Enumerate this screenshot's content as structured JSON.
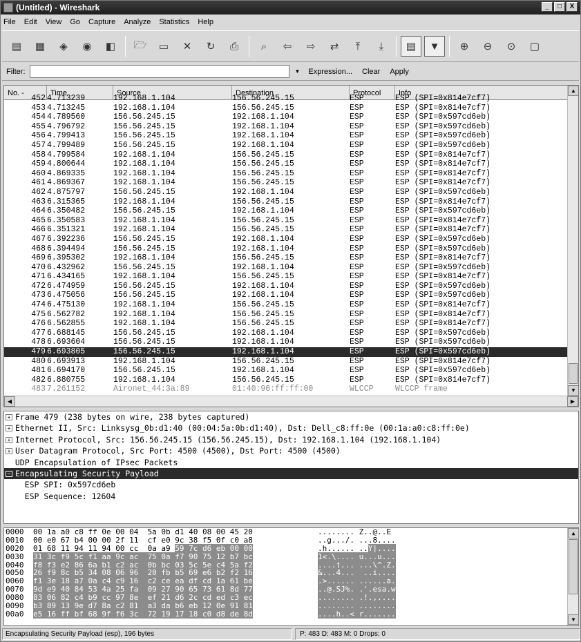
{
  "window": {
    "title": "(Untitled) - Wireshark",
    "minimize": "_",
    "maximize": "□",
    "close": "X"
  },
  "menu": [
    "File",
    "Edit",
    "View",
    "Go",
    "Capture",
    "Analyze",
    "Statistics",
    "Help"
  ],
  "toolbar": [
    {
      "icon": "interface-list-icon",
      "glyph": "▤"
    },
    {
      "icon": "capture-options-icon",
      "glyph": "▦"
    },
    {
      "icon": "start-capture-icon",
      "glyph": "◈"
    },
    {
      "icon": "stop-capture-icon",
      "glyph": "◉"
    },
    {
      "icon": "restart-capture-icon",
      "glyph": "◧"
    },
    {
      "icon": "open-file-icon",
      "glyph": "🗁"
    },
    {
      "icon": "save-file-icon",
      "glyph": "▭"
    },
    {
      "icon": "close-file-icon",
      "glyph": "✕"
    },
    {
      "icon": "reload-icon",
      "glyph": "↻"
    },
    {
      "icon": "print-icon",
      "glyph": "⎙"
    },
    {
      "icon": "find-packet-icon",
      "glyph": "⌕"
    },
    {
      "icon": "go-back-icon",
      "glyph": "⇦"
    },
    {
      "icon": "go-forward-icon",
      "glyph": "⇨"
    },
    {
      "icon": "go-to-packet-icon",
      "glyph": "⇄"
    },
    {
      "icon": "go-first-icon",
      "glyph": "⤒"
    },
    {
      "icon": "go-last-icon",
      "glyph": "⤓"
    },
    {
      "icon": "colorize-icon",
      "glyph": "▤"
    },
    {
      "icon": "auto-scroll-icon",
      "glyph": "▼"
    },
    {
      "icon": "zoom-in-icon",
      "glyph": "⊕"
    },
    {
      "icon": "zoom-out-icon",
      "glyph": "⊖"
    },
    {
      "icon": "normal-size-icon",
      "glyph": "⊙"
    },
    {
      "icon": "resize-columns-icon",
      "glyph": "▢"
    }
  ],
  "filter": {
    "label": "Filter:",
    "value": "",
    "expression": "Expression...",
    "clear": "Clear",
    "apply": "Apply"
  },
  "columns": [
    "No. -",
    "Time",
    "Source",
    "Destination",
    "Protocol",
    "Info"
  ],
  "packets": [
    [
      "452",
      "4.713239",
      "192.168.1.104",
      "156.56.245.15",
      "ESP",
      "ESP (SPI=0x814e7cf7)"
    ],
    [
      "453",
      "4.713245",
      "192.168.1.104",
      "156.56.245.15",
      "ESP",
      "ESP (SPI=0x814e7cf7)"
    ],
    [
      "454",
      "4.789560",
      "156.56.245.15",
      "192.168.1.104",
      "ESP",
      "ESP (SPI=0x597cd6eb)"
    ],
    [
      "455",
      "4.796792",
      "156.56.245.15",
      "192.168.1.104",
      "ESP",
      "ESP (SPI=0x597cd6eb)"
    ],
    [
      "456",
      "4.799413",
      "156.56.245.15",
      "192.168.1.104",
      "ESP",
      "ESP (SPI=0x597cd6eb)"
    ],
    [
      "457",
      "4.799489",
      "156.56.245.15",
      "192.168.1.104",
      "ESP",
      "ESP (SPI=0x597cd6eb)"
    ],
    [
      "458",
      "4.799584",
      "192.168.1.104",
      "156.56.245.15",
      "ESP",
      "ESP (SPI=0x814e7cf7)"
    ],
    [
      "459",
      "4.800644",
      "192.168.1.104",
      "156.56.245.15",
      "ESP",
      "ESP (SPI=0x814e7cf7)"
    ],
    [
      "460",
      "4.869335",
      "192.168.1.104",
      "156.56.245.15",
      "ESP",
      "ESP (SPI=0x814e7cf7)"
    ],
    [
      "461",
      "4.869367",
      "192.168.1.104",
      "156.56.245.15",
      "ESP",
      "ESP (SPI=0x814e7cf7)"
    ],
    [
      "462",
      "4.875797",
      "156.56.245.15",
      "192.168.1.104",
      "ESP",
      "ESP (SPI=0x597cd6eb)"
    ],
    [
      "463",
      "6.315365",
      "192.168.1.104",
      "156.56.245.15",
      "ESP",
      "ESP (SPI=0x814e7cf7)"
    ],
    [
      "464",
      "6.350482",
      "156.56.245.15",
      "192.168.1.104",
      "ESP",
      "ESP (SPI=0x597cd6eb)"
    ],
    [
      "465",
      "6.350583",
      "192.168.1.104",
      "156.56.245.15",
      "ESP",
      "ESP (SPI=0x814e7cf7)"
    ],
    [
      "466",
      "6.351321",
      "192.168.1.104",
      "156.56.245.15",
      "ESP",
      "ESP (SPI=0x814e7cf7)"
    ],
    [
      "467",
      "6.392236",
      "156.56.245.15",
      "192.168.1.104",
      "ESP",
      "ESP (SPI=0x597cd6eb)"
    ],
    [
      "468",
      "6.394494",
      "156.56.245.15",
      "192.168.1.104",
      "ESP",
      "ESP (SPI=0x597cd6eb)"
    ],
    [
      "469",
      "6.395302",
      "192.168.1.104",
      "156.56.245.15",
      "ESP",
      "ESP (SPI=0x814e7cf7)"
    ],
    [
      "470",
      "6.432962",
      "156.56.245.15",
      "192.168.1.104",
      "ESP",
      "ESP (SPI=0x597cd6eb)"
    ],
    [
      "471",
      "6.434165",
      "192.168.1.104",
      "156.56.245.15",
      "ESP",
      "ESP (SPI=0x814e7cf7)"
    ],
    [
      "472",
      "6.474959",
      "156.56.245.15",
      "192.168.1.104",
      "ESP",
      "ESP (SPI=0x597cd6eb)"
    ],
    [
      "473",
      "6.475056",
      "156.56.245.15",
      "192.168.1.104",
      "ESP",
      "ESP (SPI=0x597cd6eb)"
    ],
    [
      "474",
      "6.475130",
      "192.168.1.104",
      "156.56.245.15",
      "ESP",
      "ESP (SPI=0x814e7cf7)"
    ],
    [
      "475",
      "6.562782",
      "192.168.1.104",
      "156.56.245.15",
      "ESP",
      "ESP (SPI=0x814e7cf7)"
    ],
    [
      "476",
      "6.562855",
      "192.168.1.104",
      "156.56.245.15",
      "ESP",
      "ESP (SPI=0x814e7cf7)"
    ],
    [
      "477",
      "6.688145",
      "156.56.245.15",
      "192.168.1.104",
      "ESP",
      "ESP (SPI=0x597cd6eb)"
    ],
    [
      "478",
      "6.693604",
      "156.56.245.15",
      "192.168.1.104",
      "ESP",
      "ESP (SPI=0x597cd6eb)"
    ],
    [
      "479",
      "6.693805",
      "156.56.245.15",
      "192.168.1.104",
      "ESP",
      "ESP (SPI=0x597cd6eb)"
    ],
    [
      "480",
      "6.693913",
      "192.168.1.104",
      "156.56.245.15",
      "ESP",
      "ESP (SPI=0x814e7cf7)"
    ],
    [
      "481",
      "6.694170",
      "156.56.245.15",
      "192.168.1.104",
      "ESP",
      "ESP (SPI=0x597cd6eb)"
    ],
    [
      "482",
      "6.880755",
      "192.168.1.104",
      "156.56.245.15",
      "ESP",
      "ESP (SPI=0x814e7cf7)"
    ],
    [
      "483",
      "7.261152",
      "Aironet_44:3a:89",
      "01:40:96:ff:ff:00",
      "WLCCP",
      "WLCCP frame"
    ]
  ],
  "selected_packet": "479",
  "dimmed_packet": "483",
  "details": [
    {
      "exp": "⊞",
      "text": "Frame 479 (238 bytes on wire, 238 bytes captured)"
    },
    {
      "exp": "⊞",
      "text": "Ethernet II, Src: Linksysg_0b:d1:40 (00:04:5a:0b:d1:40), Dst: Dell_c8:ff:0e (00:1a:a0:c8:ff:0e)"
    },
    {
      "exp": "⊞",
      "text": "Internet Protocol, Src: 156.56.245.15 (156.56.245.15), Dst: 192.168.1.104 (192.168.1.104)"
    },
    {
      "exp": "⊞",
      "text": "User Datagram Protocol, Src Port: 4500 (4500), Dst Port: 4500 (4500)"
    },
    {
      "exp": "",
      "text": "  UDP Encapsulation of IPsec Packets"
    },
    {
      "exp": "⊟",
      "text": "Encapsulating Security Payload",
      "sel": true
    },
    {
      "exp": "",
      "text": "    ESP SPI: 0x597cd6eb"
    },
    {
      "exp": "",
      "text": "    ESP Sequence: 12604"
    }
  ],
  "hex": [
    {
      "off": "0000",
      "a": "00 1a a0 c8 ff 0e 00 04  5a 0b d1 40 08 00 45 20",
      "b": "",
      "asc_a": "........ Z..@..E ",
      "asc_b": ""
    },
    {
      "off": "0010",
      "a": "00 e0 67 b4 00 00 2f 11  cf e0 9c 38 f5 0f c0 a8",
      "b": "",
      "asc_a": "..g.../. ...8....",
      "asc_b": ""
    },
    {
      "off": "0020",
      "a": "01 68 11 94 11 94 00 cc  0a a9 ",
      "b": "59 7c d6 eb 00 00",
      "asc_a": ".h...... ..",
      "asc_b": "Y|...."
    },
    {
      "off": "0030",
      "a": "",
      "b": "31 3c f9 5c f1 aa 9c ac  75 0a f7 90 75 12 b7 bc",
      "asc_a": "",
      "asc_b": "1<.\\.... u...u..."
    },
    {
      "off": "0040",
      "a": "",
      "b": "f8 f3 e2 86 6a b1 c2 ac  0b bc 03 5c 5e c4 5a f2",
      "asc_a": "",
      "asc_b": "....j... ...\\^.Z."
    },
    {
      "off": "0050",
      "a": "",
      "b": "26 f9 8c b5 34 08 06 96  20 fb b5 69 e6 b2 f2 16",
      "asc_a": "",
      "asc_b": "&...4...  ..i...."
    },
    {
      "off": "0060",
      "a": "",
      "b": "f1 3e 18 a7 0a c4 c9 16  c2 ce ea df cd 1a 61 be",
      "asc_a": "",
      "asc_b": ".>...... ......a."
    },
    {
      "off": "0070",
      "a": "",
      "b": "9d e9 40 84 53 4a 25 fa  09 27 90 65 73 61 8d 77",
      "asc_a": "",
      "asc_b": "..@.SJ%. .'.esa.w"
    },
    {
      "off": "0080",
      "a": "",
      "b": "83 06 82 c4 b9 cc 97 8e  ef 21 d6 2c cd ed c3 ec",
      "asc_a": "",
      "asc_b": "........ .!.,...."
    },
    {
      "off": "0090",
      "a": "",
      "b": "b3 89 13 9e d7 8a c2 81  a3 da b6 eb 12 0e 91 81",
      "asc_a": "",
      "asc_b": "........ ........"
    },
    {
      "off": "00a0",
      "a": "",
      "b": "e5 16 ff bf 68 9f f6 3c  72 19 17 18 c0 d8 de 8d",
      "asc_a": "",
      "asc_b": "....h..< r......."
    }
  ],
  "status": {
    "left": "Encapsulating Security Payload (esp), 196 bytes",
    "right": "P: 483 D: 483 M: 0 Drops: 0"
  },
  "colors": {
    "selection": "#2a2a2a",
    "titlebar": "#2a2a2a",
    "hex_highlight": "#8c8c8c"
  }
}
